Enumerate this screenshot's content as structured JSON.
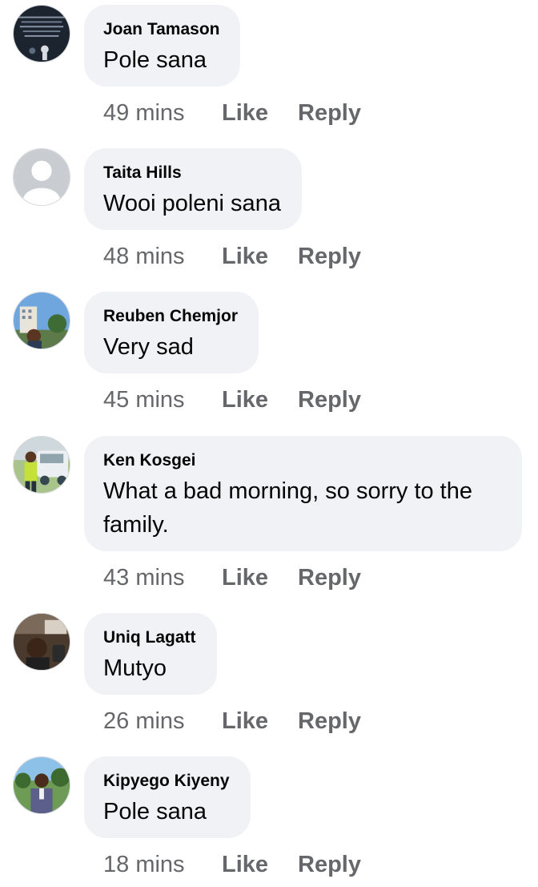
{
  "comments": [
    {
      "author": "Joan Tamason",
      "text": "Pole sana",
      "time": "49 mins",
      "like_label": "Like",
      "reply_label": "Reply",
      "avatar_icon": "profile-photo-dark-quote"
    },
    {
      "author": "Taita Hills",
      "text": "Wooi poleni sana",
      "time": "48 mins",
      "like_label": "Like",
      "reply_label": "Reply",
      "avatar_icon": "default-profile-silhouette"
    },
    {
      "author": "Reuben Chemjor",
      "text": "Very sad",
      "time": "45 mins",
      "like_label": "Like",
      "reply_label": "Reply",
      "avatar_icon": "profile-photo-building"
    },
    {
      "author": "Ken Kosgei",
      "text": "What a bad morning, so sorry to the family.",
      "time": "43 mins",
      "like_label": "Like",
      "reply_label": "Reply",
      "avatar_icon": "profile-photo-vehicle"
    },
    {
      "author": "Uniq Lagatt",
      "text": "Mutyo",
      "time": "26 mins",
      "like_label": "Like",
      "reply_label": "Reply",
      "avatar_icon": "profile-photo-car-selfie"
    },
    {
      "author": "Kipyego Kiyeny",
      "text": "Pole sana",
      "time": "18 mins",
      "like_label": "Like",
      "reply_label": "Reply",
      "avatar_icon": "profile-photo-outdoor"
    }
  ],
  "colors": {
    "bubble_bg": "#f0f2f5",
    "primary_text": "#050505",
    "secondary_text": "#65676b"
  }
}
